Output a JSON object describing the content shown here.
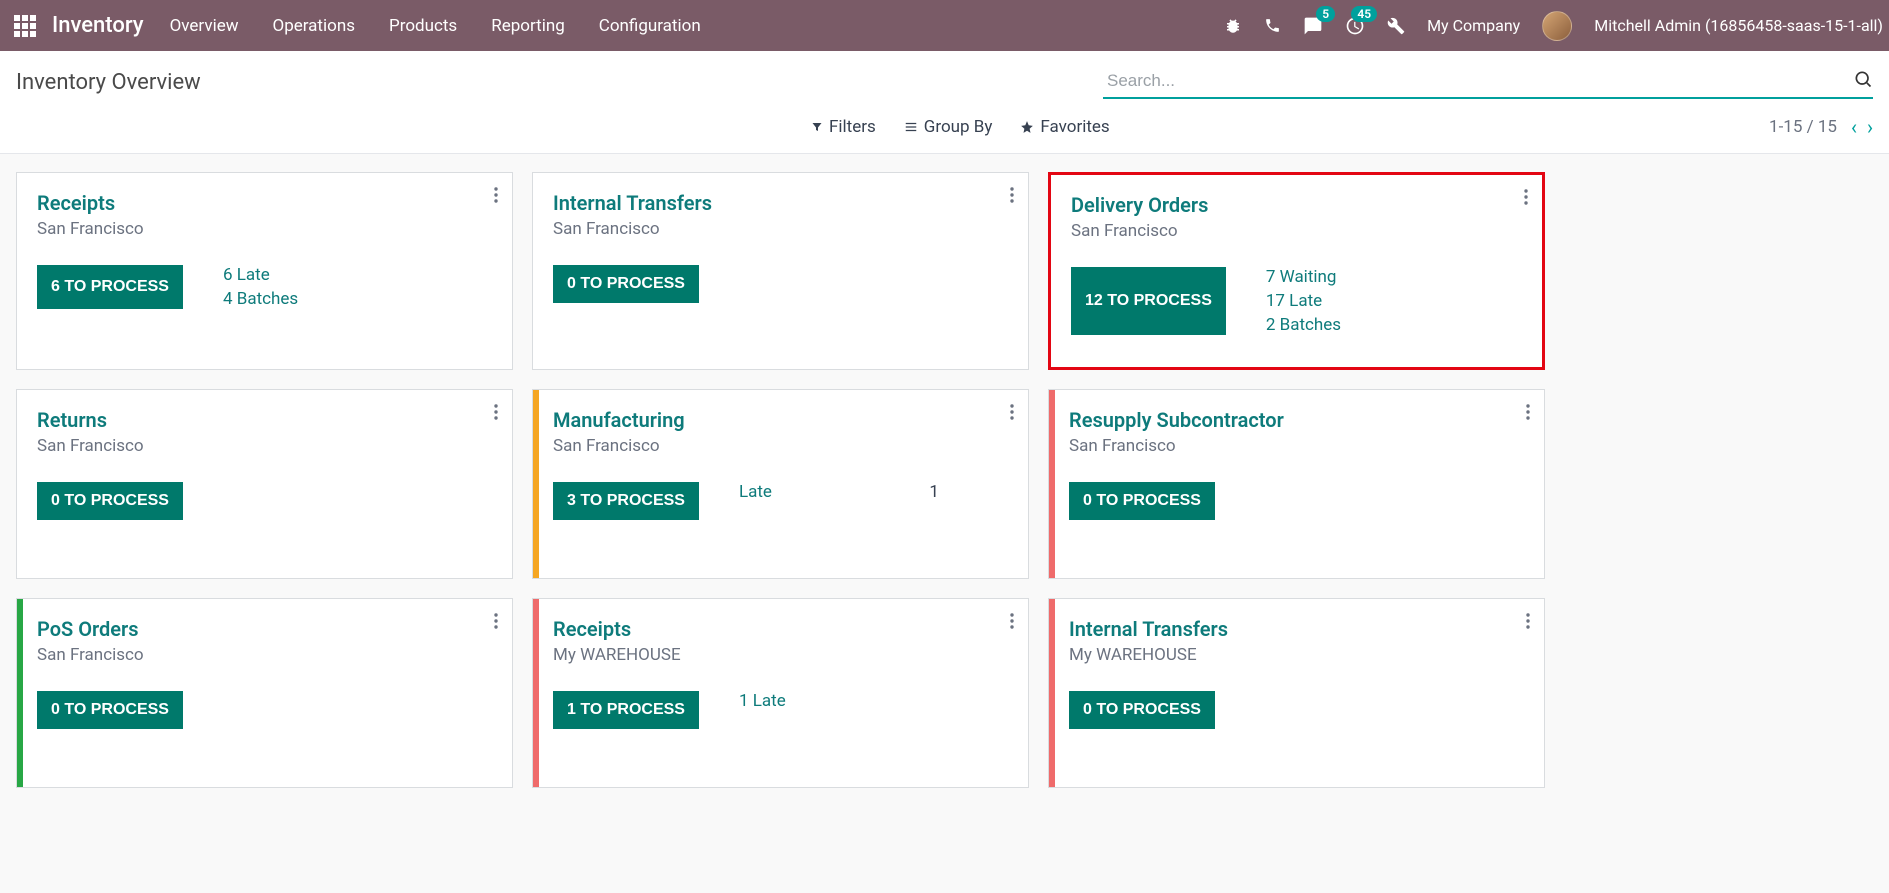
{
  "app": {
    "title": "Inventory",
    "nav": [
      "Overview",
      "Operations",
      "Products",
      "Reporting",
      "Configuration"
    ]
  },
  "topbar": {
    "messages_badge": "5",
    "activities_badge": "45",
    "company": "My Company",
    "user": "Mitchell Admin (16856458-saas-15-1-all)"
  },
  "page": {
    "title": "Inventory Overview",
    "search_placeholder": "Search...",
    "filters": "Filters",
    "groupby": "Group By",
    "favorites": "Favorites",
    "pager": "1-15 / 15"
  },
  "cards": [
    {
      "title": "Receipts",
      "sub": "San Francisco",
      "button": "6 TO PROCESS",
      "links": [
        {
          "text": "6 Late"
        },
        {
          "text": "4 Batches"
        }
      ],
      "bar": "",
      "highlighted": false
    },
    {
      "title": "Internal Transfers",
      "sub": "San Francisco",
      "button": "0 TO PROCESS",
      "links": [],
      "bar": "",
      "highlighted": false
    },
    {
      "title": "Delivery Orders",
      "sub": "San Francisco",
      "button": "12 TO PROCESS",
      "links": [
        {
          "text": "7 Waiting"
        },
        {
          "text": "17 Late"
        },
        {
          "text": "2 Batches"
        }
      ],
      "bar": "",
      "highlighted": true
    },
    {
      "title": "Returns",
      "sub": "San Francisco",
      "button": "0 TO PROCESS",
      "links": [],
      "bar": "",
      "highlighted": false
    },
    {
      "title": "Manufacturing",
      "sub": "San Francisco",
      "button": "3 TO PROCESS",
      "links": [
        {
          "label": "Late",
          "value": "1"
        }
      ],
      "bar": "orange",
      "highlighted": false
    },
    {
      "title": "Resupply Subcontractor",
      "sub": "San Francisco",
      "button": "0 TO PROCESS",
      "links": [],
      "bar": "red",
      "highlighted": false
    },
    {
      "title": "PoS Orders",
      "sub": "San Francisco",
      "button": "0 TO PROCESS",
      "links": [],
      "bar": "green",
      "highlighted": false
    },
    {
      "title": "Receipts",
      "sub": "My WAREHOUSE",
      "button": "1 TO PROCESS",
      "links": [
        {
          "text": "1 Late"
        }
      ],
      "bar": "red",
      "highlighted": false
    },
    {
      "title": "Internal Transfers",
      "sub": "My WAREHOUSE",
      "button": "0 TO PROCESS",
      "links": [],
      "bar": "red",
      "highlighted": false
    }
  ]
}
